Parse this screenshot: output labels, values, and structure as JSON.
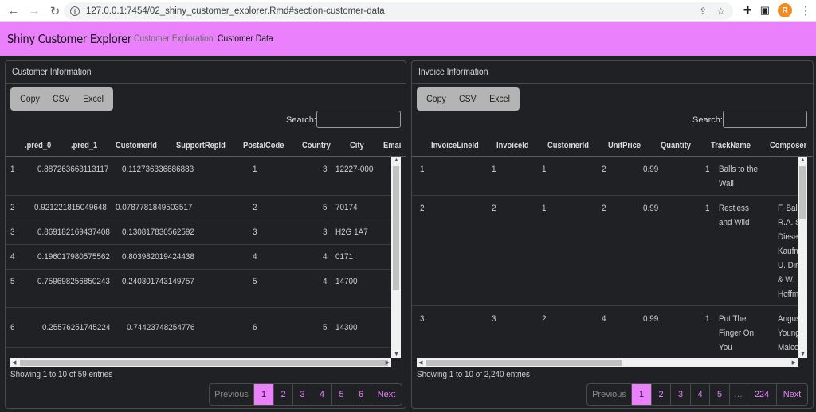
{
  "browser": {
    "url": "127.0.0.1:7454/02_shiny_customer_explorer.Rmd#section-customer-data",
    "profile_initial": "R"
  },
  "navbar": {
    "brand": "Shiny Customer Explorer",
    "tabs": [
      {
        "label": "Customer Exploration",
        "active": false
      },
      {
        "label": "Customer Data",
        "active": true
      }
    ]
  },
  "colors": {
    "accent": "#ea80fc",
    "background": "#202124"
  },
  "customer_panel": {
    "title": "Customer Information",
    "buttons": [
      "Copy",
      "CSV",
      "Excel"
    ],
    "search_label": "Search:",
    "columns": [
      ".pred_0",
      ".pred_1",
      "CustomerId",
      "SupportRepId",
      "PostalCode",
      "Country",
      "City",
      "Emai"
    ],
    "rows": [
      [
        "1",
        "0.887263663113117",
        "0.112736336886883",
        "1",
        "3",
        "12227-000"
      ],
      [
        "2",
        "0.921221815049648",
        "0.0787781849503517",
        "2",
        "5",
        "70174"
      ],
      [
        "3",
        "0.869182169437408",
        "0.130817830562592",
        "3",
        "3",
        "H2G 1A7"
      ],
      [
        "4",
        "0.196017980575562",
        "0.803982019424438",
        "4",
        "4",
        "0171"
      ],
      [
        "5",
        "0.759698256850243",
        "0.240301743149757",
        "5",
        "4",
        "14700"
      ],
      [
        "6",
        "0.25576251745224",
        "0.74423748254776",
        "6",
        "5",
        "14300"
      ]
    ],
    "info": "Showing 1 to 10 of 59 entries",
    "pagination": [
      "Previous",
      "1",
      "2",
      "3",
      "4",
      "5",
      "6",
      "Next"
    ]
  },
  "invoice_panel": {
    "title": "Invoice Information",
    "buttons": [
      "Copy",
      "CSV",
      "Excel"
    ],
    "search_label": "Search:",
    "columns": [
      "InvoiceLineId",
      "InvoiceId",
      "CustomerId",
      "UnitPrice",
      "Quantity",
      "TrackName",
      "Composer"
    ],
    "rows": [
      {
        "cells": [
          "1",
          "1",
          "1",
          "2",
          "0.99",
          "1"
        ],
        "track": "Balls to the Wall",
        "composer": ""
      },
      {
        "cells": [
          "2",
          "2",
          "1",
          "2",
          "0.99",
          "1"
        ],
        "track": "Restless and Wild",
        "composer": "F. Baltes, R.A. Smith-Diesel, S. Kaufman, U. Dirksen & W. Hoffman"
      },
      {
        "cells": [
          "3",
          "3",
          "2",
          "4",
          "0.99",
          "1"
        ],
        "track": "Put The Finger On You",
        "composer": "Angus Young, Malcolm"
      }
    ],
    "info": "Showing 1 to 10 of 2,240 entries",
    "pagination": [
      "Previous",
      "1",
      "2",
      "3",
      "4",
      "5",
      "…",
      "224",
      "Next"
    ]
  }
}
